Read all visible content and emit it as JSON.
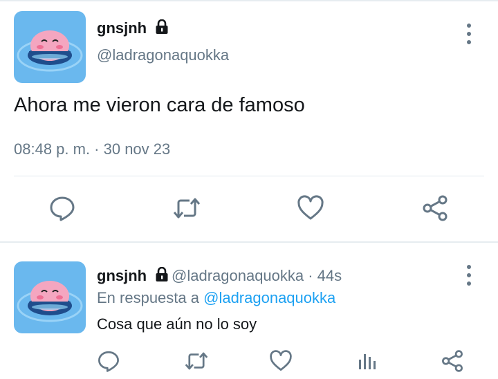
{
  "main_tweet": {
    "display_name": "gnsjnh",
    "handle": "@ladragonaquokka",
    "text": "Ahora me vieron cara de famoso",
    "timestamp": "08:48 p. m. · 30 nov 23"
  },
  "reply_tweet": {
    "display_name": "gnsjnh",
    "handle_time": "@ladragonaquokka · 44s",
    "in_reply_prefix": "En respuesta a",
    "in_reply_mention": "@ladragonaquokka",
    "text": "Cosa que aún no lo soy"
  },
  "colors": {
    "accent": "#1da1f2",
    "secondary_text": "#657786",
    "icon": "#657786",
    "avatar_water": "#5fb3ea",
    "avatar_kirby": "#f4a6c0"
  }
}
